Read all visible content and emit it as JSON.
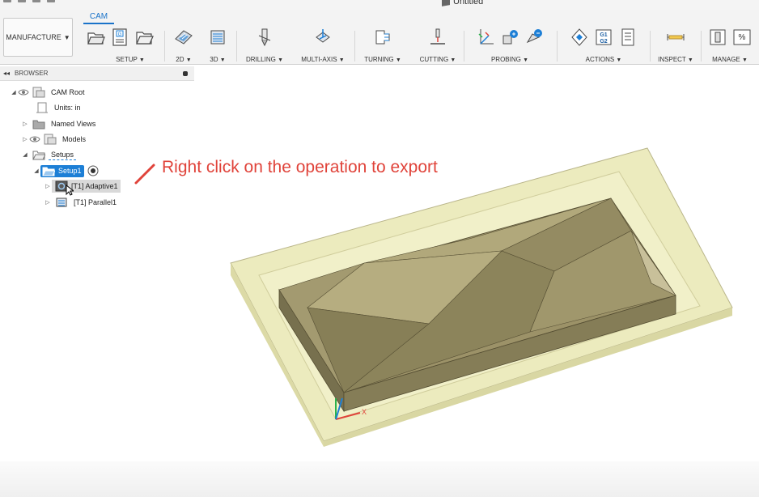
{
  "window": {
    "title": "Untitled"
  },
  "toolbar": {
    "active_tab": "CAM",
    "workspace_label": "MANUFACTURE",
    "groups": {
      "setup": "SETUP",
      "two_d": "2D",
      "three_d": "3D",
      "drilling": "DRILLING",
      "multi_axis": "MULTI-AXIS",
      "turning": "TURNING",
      "cutting": "CUTTING",
      "probing": "PROBING",
      "actions": "ACTIONS",
      "inspect": "INSPECT",
      "manage": "MANAGE"
    },
    "g1g2_text": "G1\nG2",
    "percent_text": "%"
  },
  "browser": {
    "title": "BROWSER",
    "items": [
      {
        "label": "CAM Root"
      },
      {
        "label": "Units: in"
      },
      {
        "label": "Named Views"
      },
      {
        "label": "Models"
      },
      {
        "label": "Setups"
      },
      {
        "label": "Setup1"
      },
      {
        "label": "[T1] Adaptive1"
      },
      {
        "label": "[T1] Parallel1"
      }
    ]
  },
  "annotation": {
    "text": "Right click on the operation to export"
  },
  "colors": {
    "accent": "#1d7fd6",
    "annotation": "#e0433a",
    "stock": "#e9e7b9",
    "part": "#8f8660"
  },
  "triad": {
    "x_label": "X"
  }
}
